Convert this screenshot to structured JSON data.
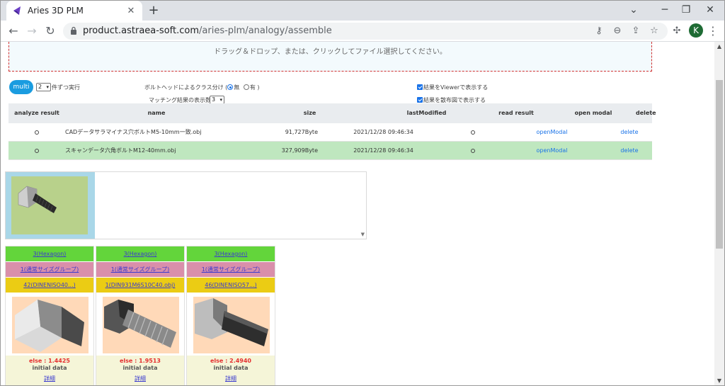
{
  "browser": {
    "tab_title": "Aries 3D PLM",
    "tab_close": "✕",
    "new_tab": "+",
    "url_host": "product.astraea-soft.com",
    "url_path": "/aries-plm/analogy/assemble",
    "avatar_letter": "K",
    "accent": "#1a73e8"
  },
  "dropzone": {
    "text": "ドラッグ＆ドロップ、または、クリックしてファイル選択してください。"
  },
  "controls": {
    "multi_label": "multi",
    "parallel_value": "2",
    "parallel_suffix": "件ずつ実行",
    "class_label": "ボルトヘッドによるクラス分け (",
    "radio_none": "無",
    "radio_yes": "有 )",
    "match_label": "マッチング結果の表示数:",
    "match_value": "3",
    "viewer_label": "結果をViewerで表示する",
    "scatter_label": "結果を散布図で表示する"
  },
  "table": {
    "headers": [
      "analyze result",
      "name",
      "size",
      "lastModified",
      "read result",
      "open modal",
      "delete"
    ],
    "rows": [
      {
        "name": "CADデータサラマイナス穴ボルトM5-10mm一致.obj",
        "size": "91,727Byte",
        "modified": "2021/12/28 09:46:34",
        "open": "openModal",
        "delete": "delete"
      },
      {
        "name": "スキャンデータ六角ボルトM12-40mm.obj",
        "size": "327,909Byte",
        "modified": "2021/12/28 09:46:34",
        "open": "openModal",
        "delete": "delete"
      }
    ]
  },
  "cards": [
    {
      "class": "3(Hexagon)",
      "group": "1(通常サイズグループ)",
      "file": "42(DINENISO40...)",
      "score": "else : 1.4425",
      "initial": "initial data",
      "detail": "詳細"
    },
    {
      "class": "3(Hexagon)",
      "group": "1(通常サイズグループ)",
      "file": "1(DIN931M6S10C40.obj)",
      "score": "else : 1.9513",
      "initial": "initial data",
      "detail": "詳細"
    },
    {
      "class": "3(Hexagon)",
      "group": "1(通常サイズグループ)",
      "file": "46(DINENISO57...)",
      "score": "else : 2.4940",
      "initial": "initial data",
      "detail": "詳細"
    }
  ]
}
